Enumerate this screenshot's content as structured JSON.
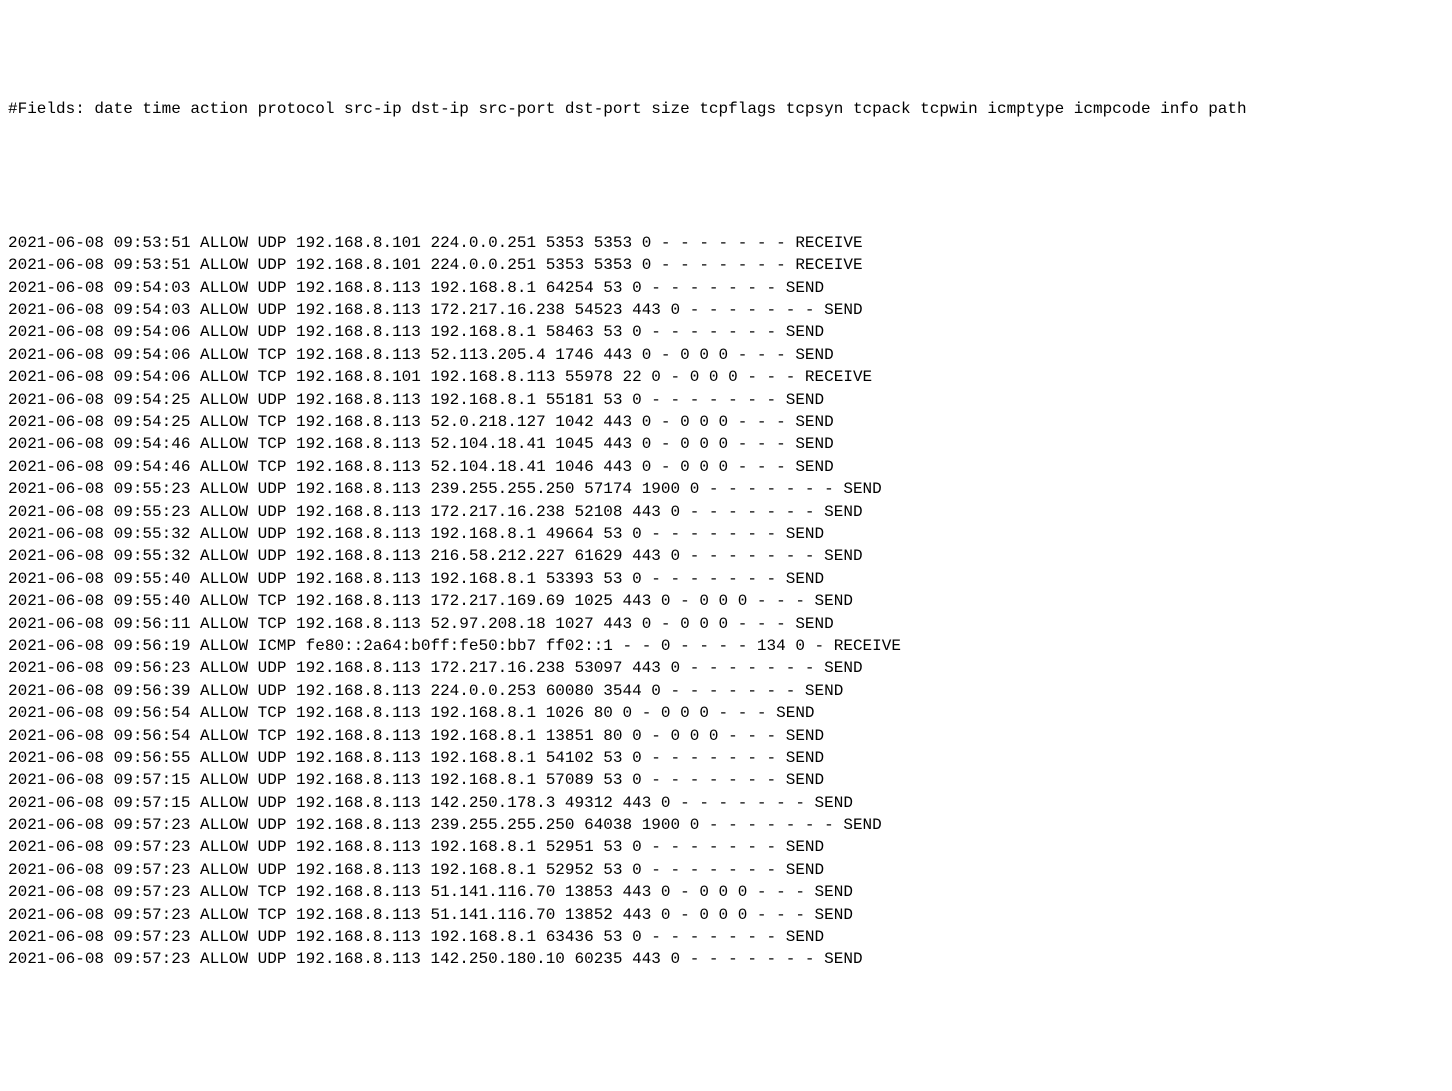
{
  "header": "#Fields: date time action protocol src-ip dst-ip src-port dst-port size tcpflags tcpsyn tcpack tcpwin icmptype icmpcode info path",
  "entries": [
    "2021-06-08 09:53:51 ALLOW UDP 192.168.8.101 224.0.0.251 5353 5353 0 - - - - - - - RECEIVE",
    "2021-06-08 09:53:51 ALLOW UDP 192.168.8.101 224.0.0.251 5353 5353 0 - - - - - - - RECEIVE",
    "2021-06-08 09:54:03 ALLOW UDP 192.168.8.113 192.168.8.1 64254 53 0 - - - - - - - SEND",
    "2021-06-08 09:54:03 ALLOW UDP 192.168.8.113 172.217.16.238 54523 443 0 - - - - - - - SEND",
    "2021-06-08 09:54:06 ALLOW UDP 192.168.8.113 192.168.8.1 58463 53 0 - - - - - - - SEND",
    "2021-06-08 09:54:06 ALLOW TCP 192.168.8.113 52.113.205.4 1746 443 0 - 0 0 0 - - - SEND",
    "2021-06-08 09:54:06 ALLOW TCP 192.168.8.101 192.168.8.113 55978 22 0 - 0 0 0 - - - RECEIVE",
    "2021-06-08 09:54:25 ALLOW UDP 192.168.8.113 192.168.8.1 55181 53 0 - - - - - - - SEND",
    "2021-06-08 09:54:25 ALLOW TCP 192.168.8.113 52.0.218.127 1042 443 0 - 0 0 0 - - - SEND",
    "2021-06-08 09:54:46 ALLOW TCP 192.168.8.113 52.104.18.41 1045 443 0 - 0 0 0 - - - SEND",
    "2021-06-08 09:54:46 ALLOW TCP 192.168.8.113 52.104.18.41 1046 443 0 - 0 0 0 - - - SEND",
    "2021-06-08 09:55:23 ALLOW UDP 192.168.8.113 239.255.255.250 57174 1900 0 - - - - - - - SEND",
    "2021-06-08 09:55:23 ALLOW UDP 192.168.8.113 172.217.16.238 52108 443 0 - - - - - - - SEND",
    "2021-06-08 09:55:32 ALLOW UDP 192.168.8.113 192.168.8.1 49664 53 0 - - - - - - - SEND",
    "2021-06-08 09:55:32 ALLOW UDP 192.168.8.113 216.58.212.227 61629 443 0 - - - - - - - SEND",
    "2021-06-08 09:55:40 ALLOW UDP 192.168.8.113 192.168.8.1 53393 53 0 - - - - - - - SEND",
    "2021-06-08 09:55:40 ALLOW TCP 192.168.8.113 172.217.169.69 1025 443 0 - 0 0 0 - - - SEND",
    "2021-06-08 09:56:11 ALLOW TCP 192.168.8.113 52.97.208.18 1027 443 0 - 0 0 0 - - - SEND",
    "2021-06-08 09:56:19 ALLOW ICMP fe80::2a64:b0ff:fe50:bb7 ff02::1 - - 0 - - - - 134 0 - RECEIVE",
    "2021-06-08 09:56:23 ALLOW UDP 192.168.8.113 172.217.16.238 53097 443 0 - - - - - - - SEND",
    "2021-06-08 09:56:39 ALLOW UDP 192.168.8.113 224.0.0.253 60080 3544 0 - - - - - - - SEND",
    "2021-06-08 09:56:54 ALLOW TCP 192.168.8.113 192.168.8.1 1026 80 0 - 0 0 0 - - - SEND",
    "2021-06-08 09:56:54 ALLOW TCP 192.168.8.113 192.168.8.1 13851 80 0 - 0 0 0 - - - SEND",
    "2021-06-08 09:56:55 ALLOW UDP 192.168.8.113 192.168.8.1 54102 53 0 - - - - - - - SEND",
    "2021-06-08 09:57:15 ALLOW UDP 192.168.8.113 192.168.8.1 57089 53 0 - - - - - - - SEND",
    "2021-06-08 09:57:15 ALLOW UDP 192.168.8.113 142.250.178.3 49312 443 0 - - - - - - - SEND",
    "2021-06-08 09:57:23 ALLOW UDP 192.168.8.113 239.255.255.250 64038 1900 0 - - - - - - - SEND",
    "2021-06-08 09:57:23 ALLOW UDP 192.168.8.113 192.168.8.1 52951 53 0 - - - - - - - SEND",
    "2021-06-08 09:57:23 ALLOW UDP 192.168.8.113 192.168.8.1 52952 53 0 - - - - - - - SEND",
    "2021-06-08 09:57:23 ALLOW TCP 192.168.8.113 51.141.116.70 13853 443 0 - 0 0 0 - - - SEND",
    "2021-06-08 09:57:23 ALLOW TCP 192.168.8.113 51.141.116.70 13852 443 0 - 0 0 0 - - - SEND",
    "2021-06-08 09:57:23 ALLOW UDP 192.168.8.113 192.168.8.1 63436 53 0 - - - - - - - SEND",
    "2021-06-08 09:57:23 ALLOW UDP 192.168.8.113 142.250.180.10 60235 443 0 - - - - - - - SEND"
  ]
}
